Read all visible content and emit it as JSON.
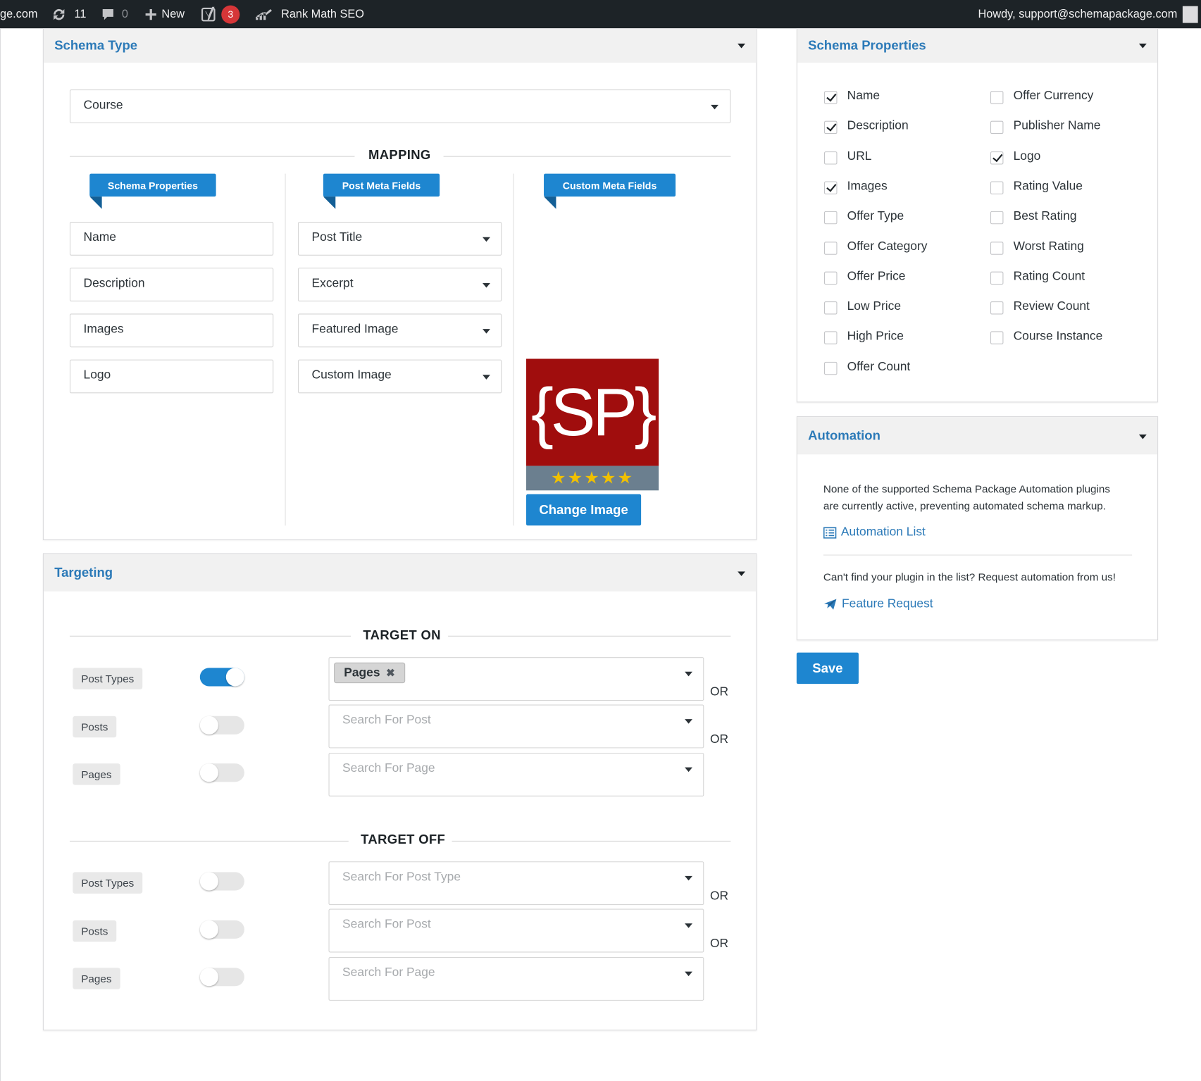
{
  "admin_bar": {
    "site": "ge.com",
    "updates_count": "11",
    "comments_count": "0",
    "new_label": "New",
    "yoast_badge": "3",
    "rankmath_label": "Rank Math SEO",
    "greeting": "Howdy, support@schemapackage.com"
  },
  "schema_type_panel": {
    "title": "Schema Type",
    "selected_type": "Course",
    "mapping_label": "MAPPING",
    "columns": [
      "Schema Properties",
      "Post Meta Fields",
      "Custom Meta Fields"
    ],
    "rows": [
      {
        "property": "Name",
        "meta": "Post Title"
      },
      {
        "property": "Description",
        "meta": "Excerpt"
      },
      {
        "property": "Images",
        "meta": "Featured Image"
      },
      {
        "property": "Logo",
        "meta": "Custom Image"
      }
    ],
    "logo_text": "{SP}",
    "logo_stars": "★★★★★",
    "change_image_label": "Change Image"
  },
  "targeting_panel": {
    "title": "Targeting",
    "target_on_label": "TARGET ON",
    "target_off_label": "TARGET OFF",
    "or_label": "OR",
    "target_on": [
      {
        "label": "Post Types",
        "enabled": true,
        "selected_chip": "Pages",
        "placeholder": ""
      },
      {
        "label": "Posts",
        "enabled": false,
        "placeholder": "Search For Post"
      },
      {
        "label": "Pages",
        "enabled": false,
        "placeholder": "Search For Page"
      }
    ],
    "target_off": [
      {
        "label": "Post Types",
        "enabled": false,
        "placeholder": "Search For Post Type"
      },
      {
        "label": "Posts",
        "enabled": false,
        "placeholder": "Search For Post"
      },
      {
        "label": "Pages",
        "enabled": false,
        "placeholder": "Search For Page"
      }
    ]
  },
  "schema_properties_panel": {
    "title": "Schema Properties",
    "left_column": [
      {
        "label": "Name",
        "checked": true
      },
      {
        "label": "Description",
        "checked": true
      },
      {
        "label": "URL",
        "checked": false
      },
      {
        "label": "Images",
        "checked": true
      },
      {
        "label": "Offer Type",
        "checked": false
      },
      {
        "label": "Offer Category",
        "checked": false
      },
      {
        "label": "Offer Price",
        "checked": false
      },
      {
        "label": "Low Price",
        "checked": false
      },
      {
        "label": "High Price",
        "checked": false
      },
      {
        "label": "Offer Count",
        "checked": false
      }
    ],
    "right_column": [
      {
        "label": "Offer Currency",
        "checked": false
      },
      {
        "label": "Publisher Name",
        "checked": false
      },
      {
        "label": "Logo",
        "checked": true
      },
      {
        "label": "Rating Value",
        "checked": false
      },
      {
        "label": "Best Rating",
        "checked": false
      },
      {
        "label": "Worst Rating",
        "checked": false
      },
      {
        "label": "Rating Count",
        "checked": false
      },
      {
        "label": "Review Count",
        "checked": false
      },
      {
        "label": "Course Instance",
        "checked": false
      }
    ]
  },
  "automation_panel": {
    "title": "Automation",
    "notice_line1": "None of the supported Schema Package Automation plugins",
    "notice_line2": "are currently active, preventing automated schema markup.",
    "automation_list_label": "Automation List",
    "request_text": "Can't find your plugin in the list? Request automation from us!",
    "feature_request_label": "Feature Request"
  },
  "save_label": "Save",
  "colors": {
    "accent": "#1e86d0",
    "title_blue": "#2c7ab8",
    "admin_bar": "#1d2327",
    "logo_red": "#a00d0d",
    "star_gold": "#f0c000"
  }
}
